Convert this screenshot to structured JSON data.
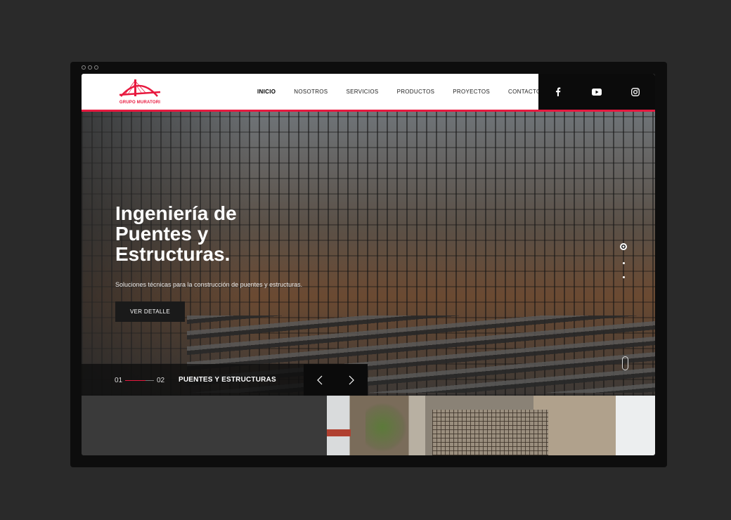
{
  "brand": {
    "name": "GRUPO MURATORI",
    "accent": "#e8193f"
  },
  "nav": {
    "items": [
      {
        "label": "INICIO",
        "active": true
      },
      {
        "label": "NOSOTROS",
        "active": false
      },
      {
        "label": "SERVICIOS",
        "active": false
      },
      {
        "label": "PRODUCTOS",
        "active": false
      },
      {
        "label": "PROYECTOS",
        "active": false
      },
      {
        "label": "CONTACTO",
        "active": false
      }
    ]
  },
  "social": {
    "icons": [
      "facebook-icon",
      "youtube-icon",
      "instagram-icon"
    ]
  },
  "hero": {
    "title_line1": "Ingeniería de",
    "title_line2": "Puentes y",
    "title_line3": "Estructuras.",
    "subtitle": "Soluciones técnicas para la construcción de puentes y estructuras.",
    "button_label": "VER DETALLE"
  },
  "slider": {
    "current": "01",
    "next": "02",
    "label": "PUENTES Y ESTRUCTURAS",
    "progress": 0.7,
    "pager_count": 3,
    "pager_active": 1
  }
}
